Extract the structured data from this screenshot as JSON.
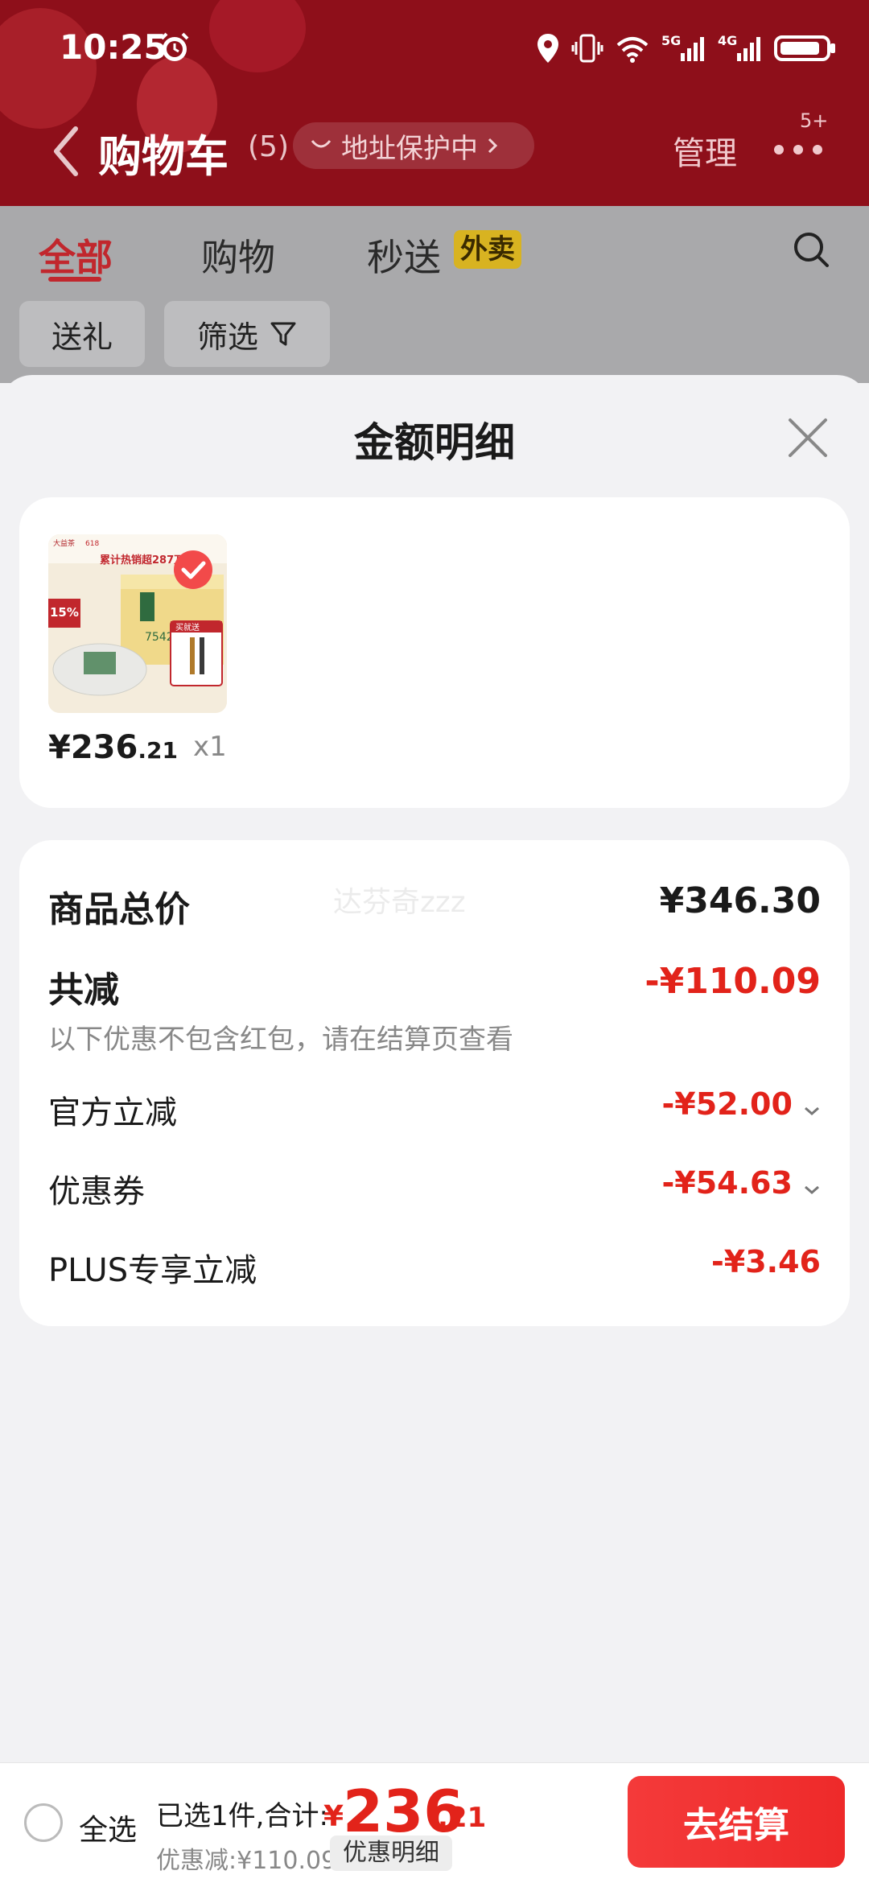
{
  "status_bar": {
    "time": "10:25",
    "net1": "5G",
    "net2": "4G"
  },
  "header": {
    "title": "购物车",
    "count": "(5)",
    "address_pill": "地址保护中",
    "manage": "管理",
    "more_badge": "5+"
  },
  "tabs": [
    {
      "label": "全部"
    },
    {
      "label": "购物"
    },
    {
      "label": "秒送"
    }
  ],
  "tag_waimai": "外卖",
  "chips": {
    "gift": "送礼",
    "filter": "筛选"
  },
  "sheet": {
    "title": "金额明细",
    "product": {
      "price_main": "¥236",
      "price_decimal": ".21",
      "quantity": "x1",
      "thumb_text": {
        "brand": "大益茶",
        "sales": "累计热销超287万",
        "badge": "15%",
        "gift": "买就送",
        "code": "7542",
        "event": "618"
      }
    },
    "summary": {
      "watermark": "达芬奇zzz",
      "total_label": "商品总价",
      "total_value": "¥346.30",
      "reduce_label": "共减",
      "reduce_value": "-¥110.09",
      "note": "以下优惠不包含红包，请在结算页查看",
      "items": [
        {
          "label": "官方立减",
          "value": "-¥52.00"
        },
        {
          "label": "优惠券",
          "value": "-¥54.63"
        },
        {
          "label": "PLUS专享立减",
          "value": "-¥3.46"
        }
      ]
    }
  },
  "bottom_bar": {
    "select_all": "全选",
    "summary": "已选1件,合计:",
    "currency": "¥",
    "total_int": "236",
    "total_dec": ".21",
    "discount": "优惠减:¥110.09",
    "detail": "优惠明细",
    "checkout": "去结算"
  },
  "colors": {
    "header_red": "#8e0f1a",
    "accent_red": "#e2231a",
    "waimai_yellow": "#d8b321"
  }
}
